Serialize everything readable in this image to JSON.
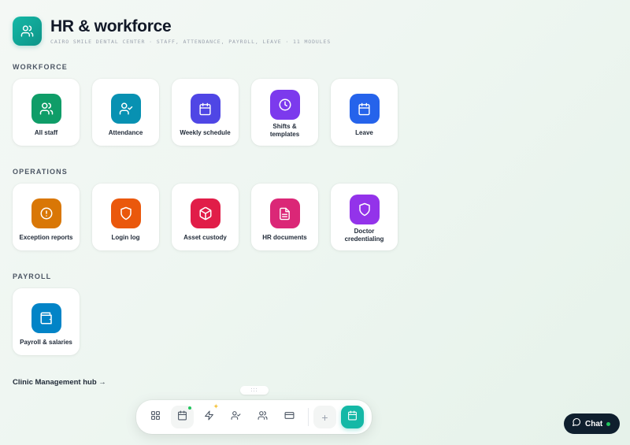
{
  "header": {
    "icon": "users-icon",
    "title": "HR & workforce",
    "subtitle": "CAIRO SMILE DENTAL CENTER · STAFF, ATTENDANCE, PAYROLL, LEAVE · 11 MODULES",
    "accent_color": "#14b8a6"
  },
  "sections": {
    "workforce": {
      "label": "WORKFORCE",
      "tiles": [
        {
          "label": "All staff",
          "icon": "users-icon",
          "color": "#0f9d68"
        },
        {
          "label": "Attendance",
          "icon": "user-check-icon",
          "color": "#0891b2"
        },
        {
          "label": "Weekly schedule",
          "icon": "calendar-icon",
          "color": "#4f46e5"
        },
        {
          "label": "Shifts & templates",
          "icon": "clock-icon",
          "color": "#7c3aed"
        },
        {
          "label": "Leave",
          "icon": "calendar-icon",
          "color": "#2563eb"
        }
      ]
    },
    "operations": {
      "label": "OPERATIONS",
      "tiles": [
        {
          "label": "Exception reports",
          "icon": "alert-circle-icon",
          "color": "#d97706"
        },
        {
          "label": "Login log",
          "icon": "shield-icon",
          "color": "#ea580c"
        },
        {
          "label": "Asset custody",
          "icon": "box-icon",
          "color": "#e11d48"
        },
        {
          "label": "HR documents",
          "icon": "document-icon",
          "color": "#db2777"
        },
        {
          "label": "Doctor credentialing",
          "icon": "shield-icon",
          "color": "#9333ea"
        }
      ]
    },
    "payroll": {
      "label": "PAYROLL",
      "tiles": [
        {
          "label": "Payroll & salaries",
          "icon": "wallet-icon",
          "color": "#0284c7"
        }
      ]
    }
  },
  "hub_link": "Clinic Management hub →",
  "drag_handle": ":::",
  "dock": {
    "items": [
      {
        "icon": "grid-icon"
      },
      {
        "icon": "calendar-icon",
        "badge": "green-dot"
      },
      {
        "icon": "zap-icon",
        "badge": "sparkle"
      },
      {
        "icon": "user-check-icon"
      },
      {
        "icon": "users-icon"
      },
      {
        "icon": "card-icon"
      },
      {
        "icon": "plus-icon"
      },
      {
        "icon": "calendar-icon",
        "active": true
      }
    ],
    "plus_label": "+"
  },
  "chat": {
    "label": "Chat",
    "icon": "message-circle-icon",
    "status_color": "#22c55e"
  }
}
